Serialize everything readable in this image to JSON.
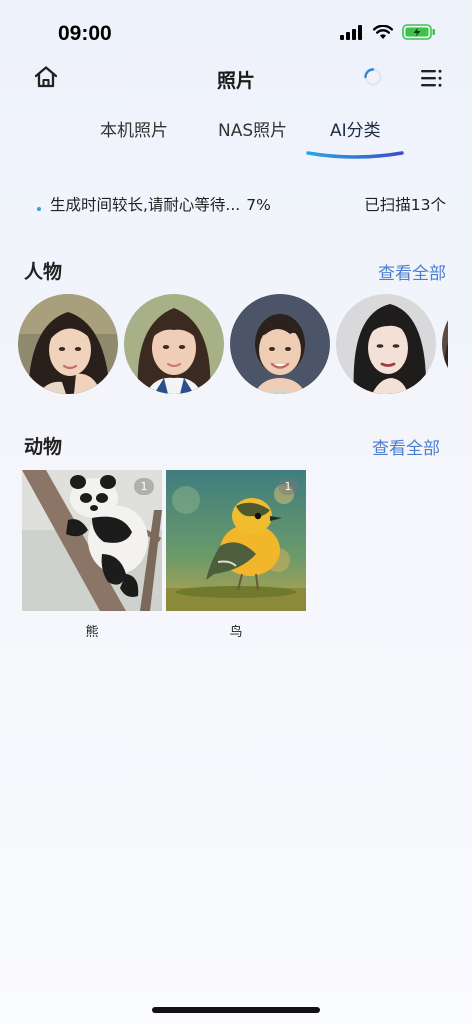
{
  "status_bar": {
    "time": "09:00"
  },
  "nav": {
    "title": "照片",
    "home_icon": "home-icon",
    "spinner_icon": "loading-spinner-icon",
    "menu_icon": "menu-list-icon"
  },
  "tabs": [
    {
      "label": "本机照片",
      "selected": false
    },
    {
      "label": "NAS照片",
      "selected": false
    },
    {
      "label": "AI分类",
      "selected": true
    }
  ],
  "scan": {
    "status_text": "生成时间较长,请耐心等待...",
    "percent": "7%",
    "count_text": "已扫描13个"
  },
  "people": {
    "title": "人物",
    "view_all": "查看全部",
    "faces": [
      "face-1",
      "face-2",
      "face-3",
      "face-4",
      "face-5"
    ]
  },
  "animals": {
    "title": "动物",
    "view_all": "查看全部",
    "items": [
      {
        "label": "熊",
        "count": "1"
      },
      {
        "label": "鸟",
        "count": "1"
      }
    ]
  },
  "colors": {
    "accent": "#4a7fd0",
    "tab_underline_start": "#2aa6e0",
    "tab_underline_end": "#3b4fc8",
    "battery": "#3ec24a"
  }
}
